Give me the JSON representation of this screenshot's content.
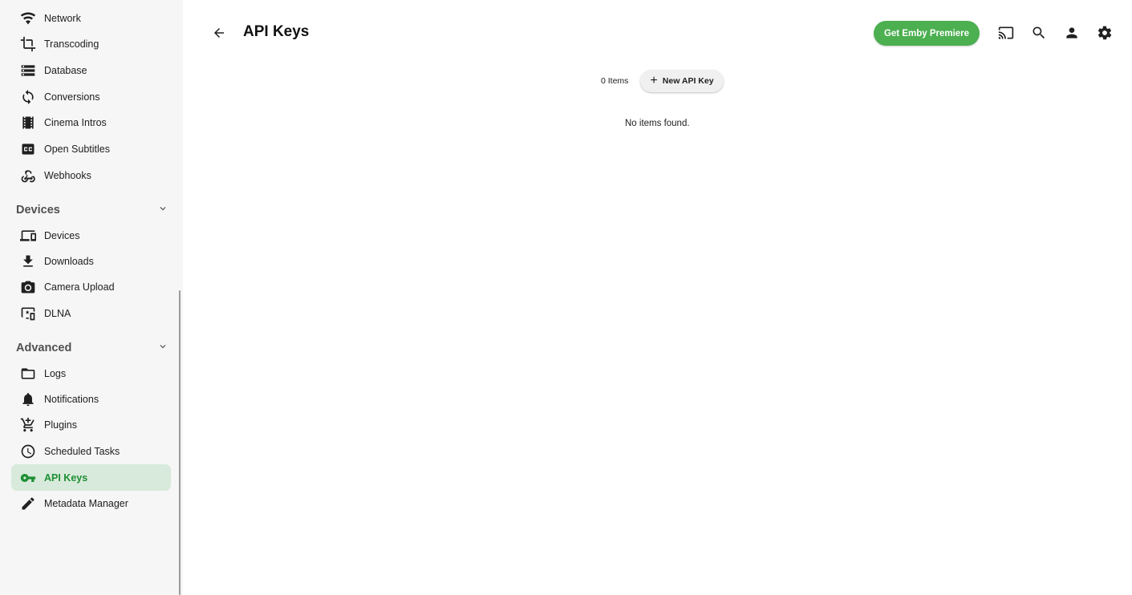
{
  "sidebar": {
    "items_top": [
      {
        "label": "Network",
        "icon": "wifi-icon"
      },
      {
        "label": "Transcoding",
        "icon": "crop-icon"
      },
      {
        "label": "Database",
        "icon": "storage-icon"
      },
      {
        "label": "Conversions",
        "icon": "sync-icon"
      },
      {
        "label": "Cinema Intros",
        "icon": "film-icon"
      },
      {
        "label": "Open Subtitles",
        "icon": "closed-caption-icon"
      },
      {
        "label": "Webhooks",
        "icon": "webhook-icon"
      }
    ],
    "devices_section": {
      "title": "Devices",
      "items": [
        {
          "label": "Devices",
          "icon": "devices-icon"
        },
        {
          "label": "Downloads",
          "icon": "download-icon"
        },
        {
          "label": "Camera Upload",
          "icon": "camera-icon"
        },
        {
          "label": "DLNA",
          "icon": "dlna-icon"
        }
      ]
    },
    "advanced_section": {
      "title": "Advanced",
      "items": [
        {
          "label": "Logs",
          "icon": "folder-icon"
        },
        {
          "label": "Notifications",
          "icon": "bell-icon"
        },
        {
          "label": "Plugins",
          "icon": "cart-icon"
        },
        {
          "label": "Scheduled Tasks",
          "icon": "clock-icon"
        },
        {
          "label": "API Keys",
          "icon": "key-icon",
          "active": true
        },
        {
          "label": "Metadata Manager",
          "icon": "pencil-icon"
        }
      ]
    }
  },
  "header": {
    "title": "API Keys",
    "premiere_label": "Get Emby Premiere",
    "accent_color": "#4caf50"
  },
  "main": {
    "items_count": "0 Items",
    "new_button_label": "New API Key",
    "empty_message": "No items found."
  }
}
